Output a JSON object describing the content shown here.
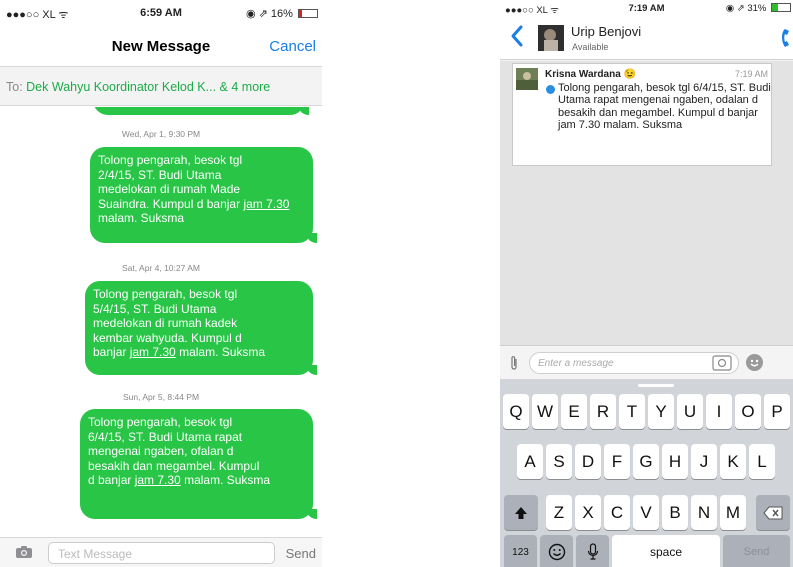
{
  "left_phone": {
    "status_bar": {
      "carrier": "●●●○○ XL ᯤ",
      "time": "6:59 AM",
      "right": "◉ ⇗ 16%",
      "battery_level": 0.16
    },
    "nav": {
      "title": "New Message",
      "cancel": "Cancel"
    },
    "to_field": {
      "label": "To: ",
      "value": "Dek Wahyu Koordinator Kelod K... & 4 more"
    },
    "thread": [
      {
        "kind": "stamp",
        "text": "Wed, Apr 1, 9:30 PM"
      },
      {
        "kind": "bubble",
        "lines": [
          "Tolong pengarah, besok tgl",
          "2/4/15, ST. Budi Utama",
          "medelokan di rumah Made",
          "Suaindra. Kumpul d banjar "
        ],
        "link": "jam 7.30",
        "tail": " malam. Suksma"
      },
      {
        "kind": "stamp",
        "text": "Sat, Apr 4, 10:27 AM"
      },
      {
        "kind": "bubble",
        "lines": [
          "Tolong pengarah, besok tgl",
          "5/4/15, ST. Budi Utama",
          "medelokan di rumah kadek",
          "kembar wahyuda. Kumpul d",
          "banjar "
        ],
        "link": "jam 7.30",
        "tail": " malam. Suksma"
      },
      {
        "kind": "stamp",
        "text": "Sun, Apr 5, 8:44 PM"
      },
      {
        "kind": "bubble",
        "lines": [
          "Tolong pengarah, besok tgl",
          "6/4/15, ST. Budi Utama rapat",
          "mengenai ngaben, ofalan d",
          "besakih dan megambel. Kumpul",
          "d banjar "
        ],
        "link": "jam 7.30",
        "tail": " malam. Suksma"
      }
    ],
    "composer": {
      "placeholder": "Text Message",
      "send": "Send",
      "camera_icon": "camera-icon"
    }
  },
  "right_phone": {
    "status_bar": {
      "carrier": "●●●○○ XL ᯤ",
      "time": "7:19 AM",
      "right": "◉ ⇗ 31%",
      "battery_level": 0.31
    },
    "header": {
      "name": "Urip Benjovi",
      "status": "Available",
      "back_icon": "chevron-left-icon",
      "call_icon": "phone-icon"
    },
    "message": {
      "sender": "Krisna Wardana 😉",
      "time": "7:19 AM",
      "text": "Tolong pengarah, besok tgl 6/4/15, ST. Budi Utama rapat mengenai ngaben, odalan d besakih dan megambel. Kumpul d banjar jam 7.30 malam. Suksma"
    },
    "composer": {
      "placeholder": "Enter a message"
    },
    "keyboard": {
      "row1": [
        "Q",
        "W",
        "E",
        "R",
        "T",
        "Y",
        "U",
        "I",
        "O",
        "P"
      ],
      "row2": [
        "A",
        "S",
        "D",
        "F",
        "G",
        "H",
        "J",
        "K",
        "L"
      ],
      "row3": [
        "Z",
        "X",
        "C",
        "V",
        "B",
        "N",
        "M"
      ],
      "bottom": {
        "numbers": "123",
        "space": "space",
        "send": "Send"
      }
    }
  },
  "colors": {
    "bubble_green": "#28c546",
    "ios_blue": "#1a7ee8",
    "to_green": "#1dab49",
    "bbm_blue": "#2a8de0"
  }
}
